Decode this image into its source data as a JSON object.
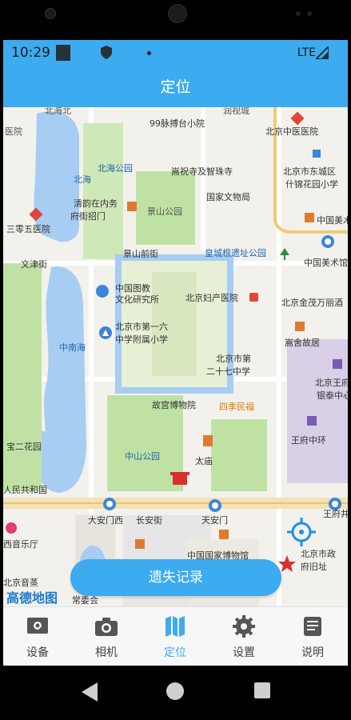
{
  "status_bar": {
    "time": "10:29",
    "network": "LTE"
  },
  "header": {
    "title": "定位"
  },
  "map": {
    "labels": [
      "北海北",
      "医院",
      "99脉搏台小院",
      "润视城",
      "北京中医医院",
      "北京市东城区",
      "什锦花园小学",
      "北海公园",
      "嵩祝寺及智珠寺",
      "国家文物局",
      "北海",
      "清韵在内务",
      "府街招门",
      "景山公园",
      "中国美术",
      "三零五医院",
      "景山前街",
      "皇城根遗址公园",
      "中国美术馆",
      "文津街",
      "中国图教",
      "文化研究所",
      "北京妇产医院",
      "北京金茂万丽酒",
      "北京市第一六",
      "中学附属小学",
      "北京市第",
      "二十七中学",
      "中南海",
      "嵩舍故居",
      "北京王府",
      "银泰中心",
      "故宫博物院",
      "四季民福",
      "中山公园",
      "王府中环",
      "太庙",
      "大安门西",
      "天安门",
      "长安街",
      "人民共和国",
      "宝二花园",
      "王府井",
      "北京市政",
      "府旧址",
      "西音乐厅",
      "北京音蒸",
      "中国国家博物馆",
      "常委会"
    ],
    "attribution": "高德地图"
  },
  "actions": {
    "lost_records": "遗失记录"
  },
  "tabs": [
    {
      "label": "设备",
      "icon": "device-icon"
    },
    {
      "label": "相机",
      "icon": "camera-icon"
    },
    {
      "label": "定位",
      "icon": "map-icon"
    },
    {
      "label": "设置",
      "icon": "gear-icon"
    },
    {
      "label": "说明",
      "icon": "document-icon"
    }
  ],
  "active_tab": "定位",
  "colors": {
    "accent": "#3dabf0",
    "water": "#a7cdf3",
    "park": "#bfe2a4",
    "forbidden_city": "#e7f0d4"
  }
}
